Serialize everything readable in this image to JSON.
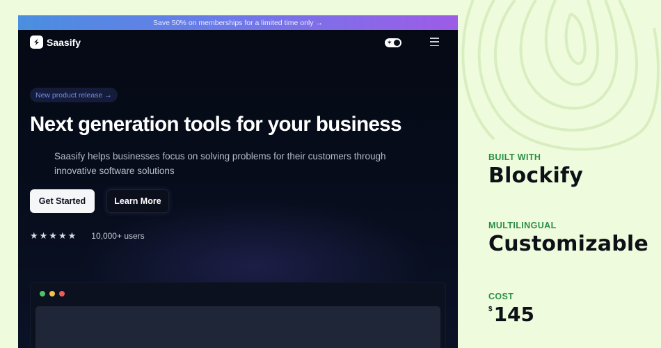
{
  "preview": {
    "promo_text": "Save 50% on memberships for a limited time only →",
    "brand": "Saasify",
    "theme_toggle_glyph": "✶",
    "badge": "New product release →",
    "title": "Next generation tools for your business",
    "subtitle": "Saasify helps businesses focus on solving problems for their customers through innovative software solutions",
    "primary_button": "Get Started",
    "secondary_button": "Learn More",
    "stars": "★★★★★",
    "users": "10,000+ users",
    "window_dots": [
      "#4cc46a",
      "#f5c04a",
      "#ef5a5a"
    ]
  },
  "info": {
    "built_with_label": "BUILT WITH",
    "built_with_value": "Blockify",
    "multilingual_label": "MULTILINGUAL",
    "multilingual_value": "Customizable",
    "cost_label": "COST",
    "cost_currency": "$",
    "cost_amount": "145"
  },
  "colors": {
    "page_bg": "#eefbdc",
    "accent_green": "#2a8e46",
    "promo_gradient": [
      "#4a8fe0",
      "#9d5ce6"
    ],
    "badge_text": "#6f8ff0"
  }
}
